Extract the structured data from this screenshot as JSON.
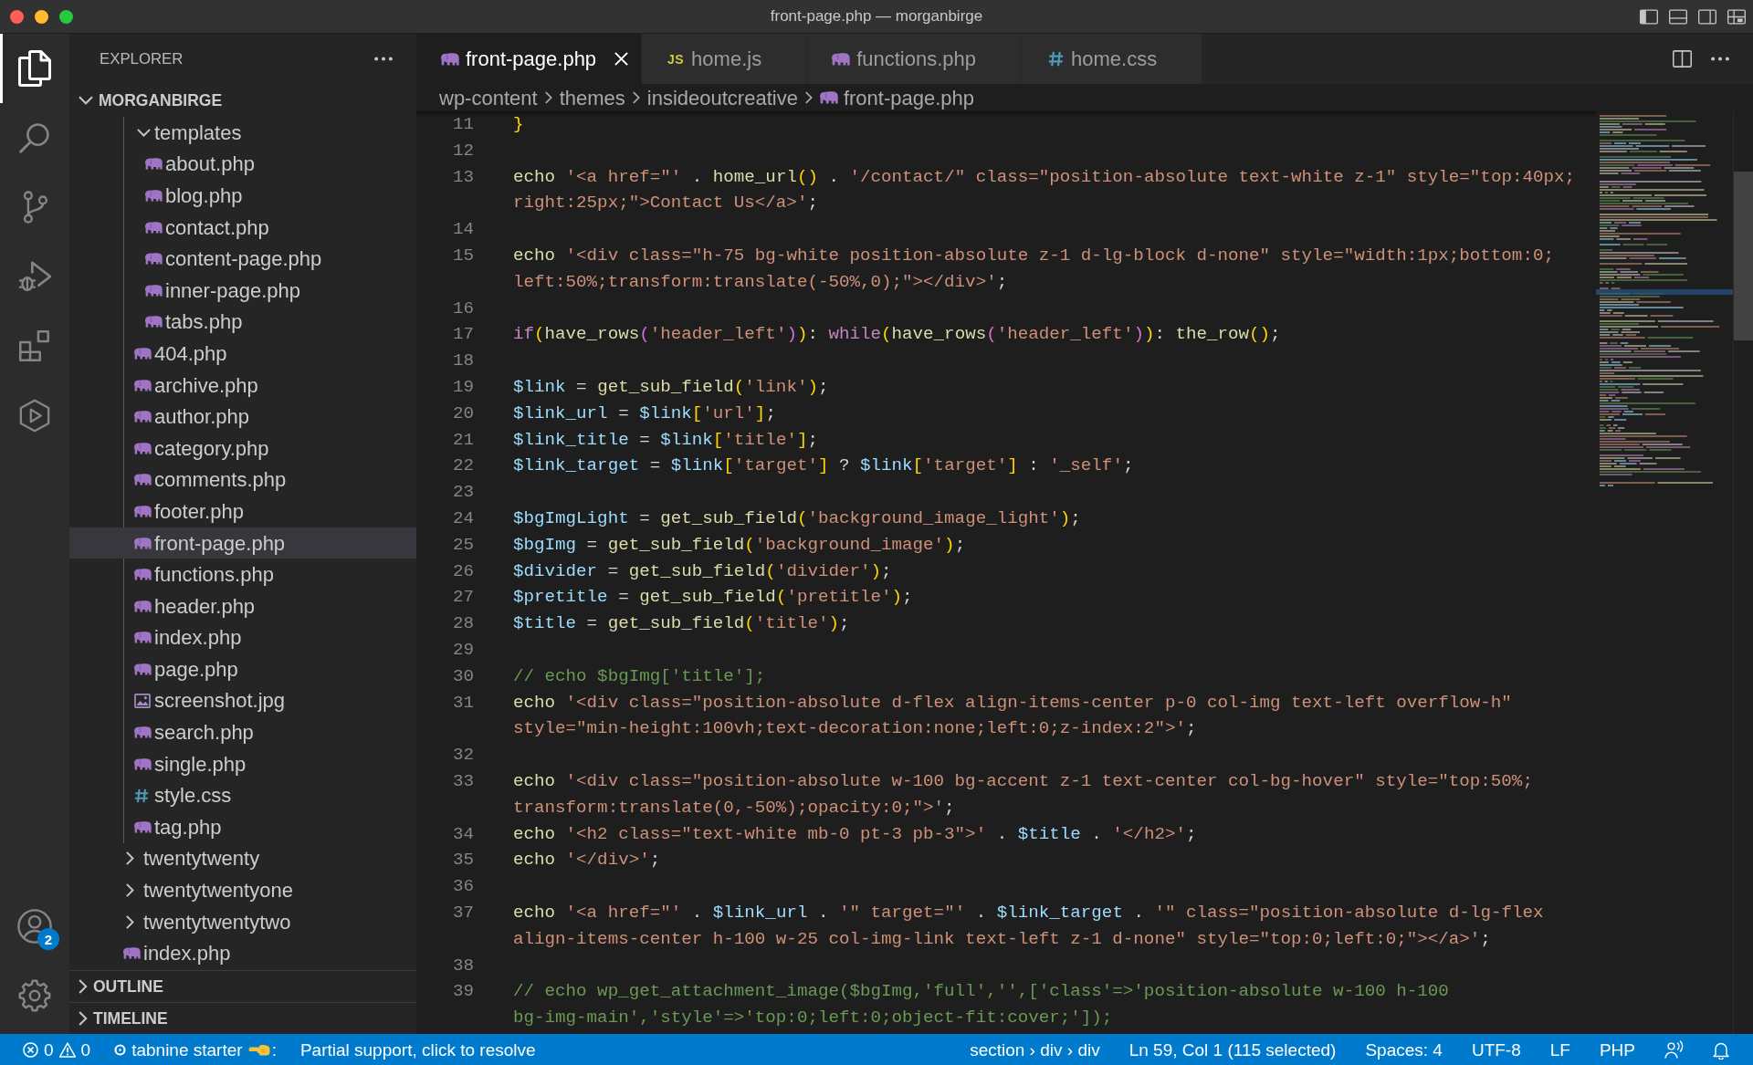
{
  "window": {
    "title": "front-page.php — morganbirge"
  },
  "activity_bar": {
    "items": [
      {
        "kind": "explorer",
        "selected": true
      },
      {
        "kind": "search",
        "selected": false
      },
      {
        "kind": "source_control",
        "selected": false
      },
      {
        "kind": "run_debug",
        "selected": false
      },
      {
        "kind": "extensions",
        "selected": false
      },
      {
        "kind": "custom",
        "selected": false
      }
    ],
    "bottom": [
      {
        "kind": "accounts",
        "badge": "2"
      },
      {
        "kind": "manage"
      }
    ]
  },
  "sidebar": {
    "title": "EXPLORER",
    "folder": {
      "title": "MORGANBIRGE",
      "expanded": true
    },
    "tree": [
      {
        "kind": "group",
        "children": [
          {
            "label": "templates",
            "kind": "folder",
            "expanded": true,
            "selected": false,
            "children": [
              {
                "label": "about.php",
                "kind": "php",
                "selected": false
              },
              {
                "label": "blog.php",
                "kind": "php",
                "selected": false
              },
              {
                "label": "contact.php",
                "kind": "php",
                "selected": false
              },
              {
                "label": "content-page.php",
                "kind": "php",
                "selected": false
              },
              {
                "label": "inner-page.php",
                "kind": "php",
                "selected": false
              },
              {
                "label": "tabs.php",
                "kind": "php",
                "selected": false
              }
            ]
          },
          {
            "label": "404.php",
            "kind": "php",
            "selected": false
          },
          {
            "label": "archive.php",
            "kind": "php",
            "selected": false
          },
          {
            "label": "author.php",
            "kind": "php",
            "selected": false
          },
          {
            "label": "category.php",
            "kind": "php",
            "selected": false
          },
          {
            "label": "comments.php",
            "kind": "php",
            "selected": false
          },
          {
            "label": "footer.php",
            "kind": "php",
            "selected": false
          },
          {
            "label": "front-page.php",
            "kind": "php",
            "selected": true
          },
          {
            "label": "functions.php",
            "kind": "php",
            "selected": false
          },
          {
            "label": "header.php",
            "kind": "php",
            "selected": false
          },
          {
            "label": "index.php",
            "kind": "php",
            "selected": false
          },
          {
            "label": "page.php",
            "kind": "php",
            "selected": false
          },
          {
            "label": "screenshot.jpg",
            "kind": "image",
            "selected": false
          },
          {
            "label": "search.php",
            "kind": "php",
            "selected": false
          },
          {
            "label": "single.php",
            "kind": "php",
            "selected": false
          },
          {
            "label": "style.css",
            "kind": "css",
            "selected": false
          },
          {
            "label": "tag.php",
            "kind": "php",
            "selected": false
          }
        ]
      },
      {
        "label": "twentytwenty",
        "kind": "folder",
        "expanded": false,
        "selected": false
      },
      {
        "label": "twentytwentyone",
        "kind": "folder",
        "expanded": false,
        "selected": false
      },
      {
        "label": "twentytwentytwo",
        "kind": "folder",
        "expanded": false,
        "selected": false
      },
      {
        "label": "index.php",
        "kind": "php",
        "selected": false
      }
    ],
    "panels": [
      {
        "title": "OUTLINE",
        "expanded": false
      },
      {
        "title": "TIMELINE",
        "expanded": false
      }
    ]
  },
  "editor": {
    "tabs": [
      {
        "label": "front-page.php",
        "kind": "php",
        "selected": true
      },
      {
        "label": "home.js",
        "kind": "js",
        "icon_text": "JS",
        "selected": false
      },
      {
        "label": "functions.php",
        "kind": "php",
        "selected": false
      },
      {
        "label": "home.css",
        "kind": "css",
        "selected": false
      }
    ],
    "breadcrumbs": [
      {
        "label": "wp-content",
        "kind": "folder"
      },
      {
        "label": "themes",
        "kind": "folder"
      },
      {
        "label": "insideoutcreative",
        "kind": "folder"
      },
      {
        "label": "front-page.php",
        "kind": "php"
      }
    ],
    "lines": [
      {
        "number": "11",
        "tokens": [
          {
            "text": "}",
            "kind": "bracket"
          }
        ]
      },
      {
        "number": "12"
      },
      {
        "number": "13",
        "tokens": [
          {
            "text": "echo ",
            "kind": "function"
          },
          {
            "text": "'<a href=\"'",
            "kind": "string"
          },
          {
            "text": " . ",
            "kind": "plain"
          },
          {
            "text": "home_url",
            "kind": "function"
          },
          {
            "text": "()",
            "kind": "bracket"
          },
          {
            "text": " . ",
            "kind": "plain"
          },
          {
            "text": "'/contact/\" class=\"position-absolute text-white z-1\" style=\"top:40px;right:25px;\">Contact Us</a>'",
            "kind": "string"
          },
          {
            "text": ";",
            "kind": "plain"
          }
        ]
      },
      {
        "number": "14"
      },
      {
        "number": "15",
        "tokens": [
          {
            "text": "echo ",
            "kind": "function"
          },
          {
            "text": "'<div class=\"h-75 bg-white position-absolute z-1 d-lg-block d-none\" style=\"width:1px;bottom:0;left:50%;transform:translate(-50%,0);\"></div>'",
            "kind": "string"
          },
          {
            "text": ";",
            "kind": "plain"
          }
        ]
      },
      {
        "number": "16"
      },
      {
        "number": "17",
        "tokens": [
          {
            "text": "if",
            "kind": "keyword"
          },
          {
            "text": "(",
            "kind": "bracket"
          },
          {
            "text": "have_rows",
            "kind": "function"
          },
          {
            "text": "(",
            "kind": "bracket_nested"
          },
          {
            "text": "'header_left'",
            "kind": "string"
          },
          {
            "text": ")",
            "kind": "bracket_nested"
          },
          {
            "text": ")",
            "kind": "bracket"
          },
          {
            "text": ": ",
            "kind": "plain"
          },
          {
            "text": "while",
            "kind": "keyword"
          },
          {
            "text": "(",
            "kind": "bracket"
          },
          {
            "text": "have_rows",
            "kind": "function"
          },
          {
            "text": "(",
            "kind": "bracket_nested"
          },
          {
            "text": "'header_left'",
            "kind": "string"
          },
          {
            "text": ")",
            "kind": "bracket_nested"
          },
          {
            "text": ")",
            "kind": "bracket"
          },
          {
            "text": ": ",
            "kind": "plain"
          },
          {
            "text": "the_row",
            "kind": "function"
          },
          {
            "text": "()",
            "kind": "bracket"
          },
          {
            "text": ";",
            "kind": "plain"
          }
        ]
      },
      {
        "number": "18"
      },
      {
        "number": "19",
        "tokens": [
          {
            "text": "$link",
            "kind": "variable"
          },
          {
            "text": " = ",
            "kind": "plain"
          },
          {
            "text": "get_sub_field",
            "kind": "function"
          },
          {
            "text": "(",
            "kind": "bracket"
          },
          {
            "text": "'link'",
            "kind": "string"
          },
          {
            "text": ")",
            "kind": "bracket"
          },
          {
            "text": ";",
            "kind": "plain"
          }
        ]
      },
      {
        "number": "20",
        "tokens": [
          {
            "text": "$link_url",
            "kind": "variable"
          },
          {
            "text": " = ",
            "kind": "plain"
          },
          {
            "text": "$link",
            "kind": "variable"
          },
          {
            "text": "[",
            "kind": "bracket"
          },
          {
            "text": "'url'",
            "kind": "string"
          },
          {
            "text": "]",
            "kind": "bracket"
          },
          {
            "text": ";",
            "kind": "plain"
          }
        ]
      },
      {
        "number": "21",
        "tokens": [
          {
            "text": "$link_title",
            "kind": "variable"
          },
          {
            "text": " = ",
            "kind": "plain"
          },
          {
            "text": "$link",
            "kind": "variable"
          },
          {
            "text": "[",
            "kind": "bracket"
          },
          {
            "text": "'title'",
            "kind": "string"
          },
          {
            "text": "]",
            "kind": "bracket"
          },
          {
            "text": ";",
            "kind": "plain"
          }
        ]
      },
      {
        "number": "22",
        "tokens": [
          {
            "text": "$link_target",
            "kind": "variable"
          },
          {
            "text": " = ",
            "kind": "plain"
          },
          {
            "text": "$link",
            "kind": "variable"
          },
          {
            "text": "[",
            "kind": "bracket"
          },
          {
            "text": "'target'",
            "kind": "string"
          },
          {
            "text": "]",
            "kind": "bracket"
          },
          {
            "text": " ? ",
            "kind": "plain"
          },
          {
            "text": "$link",
            "kind": "variable"
          },
          {
            "text": "[",
            "kind": "bracket"
          },
          {
            "text": "'target'",
            "kind": "string"
          },
          {
            "text": "]",
            "kind": "bracket"
          },
          {
            "text": " : ",
            "kind": "plain"
          },
          {
            "text": "'_self'",
            "kind": "string"
          },
          {
            "text": ";",
            "kind": "plain"
          }
        ]
      },
      {
        "number": "23"
      },
      {
        "number": "24",
        "tokens": [
          {
            "text": "$bgImgLight",
            "kind": "variable"
          },
          {
            "text": " = ",
            "kind": "plain"
          },
          {
            "text": "get_sub_field",
            "kind": "function"
          },
          {
            "text": "(",
            "kind": "bracket"
          },
          {
            "text": "'background_image_light'",
            "kind": "string"
          },
          {
            "text": ")",
            "kind": "bracket"
          },
          {
            "text": ";",
            "kind": "plain"
          }
        ]
      },
      {
        "number": "25",
        "tokens": [
          {
            "text": "$bgImg",
            "kind": "variable"
          },
          {
            "text": " = ",
            "kind": "plain"
          },
          {
            "text": "get_sub_field",
            "kind": "function"
          },
          {
            "text": "(",
            "kind": "bracket"
          },
          {
            "text": "'background_image'",
            "kind": "string"
          },
          {
            "text": ")",
            "kind": "bracket"
          },
          {
            "text": ";",
            "kind": "plain"
          }
        ]
      },
      {
        "number": "26",
        "tokens": [
          {
            "text": "$divider",
            "kind": "variable"
          },
          {
            "text": " = ",
            "kind": "plain"
          },
          {
            "text": "get_sub_field",
            "kind": "function"
          },
          {
            "text": "(",
            "kind": "bracket"
          },
          {
            "text": "'divider'",
            "kind": "string"
          },
          {
            "text": ")",
            "kind": "bracket"
          },
          {
            "text": ";",
            "kind": "plain"
          }
        ]
      },
      {
        "number": "27",
        "tokens": [
          {
            "text": "$pretitle",
            "kind": "variable"
          },
          {
            "text": " = ",
            "kind": "plain"
          },
          {
            "text": "get_sub_field",
            "kind": "function"
          },
          {
            "text": "(",
            "kind": "bracket"
          },
          {
            "text": "'pretitle'",
            "kind": "string"
          },
          {
            "text": ")",
            "kind": "bracket"
          },
          {
            "text": ";",
            "kind": "plain"
          }
        ]
      },
      {
        "number": "28",
        "tokens": [
          {
            "text": "$title",
            "kind": "variable"
          },
          {
            "text": " = ",
            "kind": "plain"
          },
          {
            "text": "get_sub_field",
            "kind": "function"
          },
          {
            "text": "(",
            "kind": "bracket"
          },
          {
            "text": "'title'",
            "kind": "string"
          },
          {
            "text": ")",
            "kind": "bracket"
          },
          {
            "text": ";",
            "kind": "plain"
          }
        ]
      },
      {
        "number": "29"
      },
      {
        "number": "30",
        "tokens": [
          {
            "text": "// echo $bgImg['title'];",
            "kind": "comment"
          }
        ]
      },
      {
        "number": "31",
        "tokens": [
          {
            "text": "echo ",
            "kind": "function"
          },
          {
            "text": "'<div class=\"position-absolute d-flex align-items-center p-0 col-img text-left overflow-h\" style=\"min-height:100vh;text-decoration:none;left:0;z-index:2\">'",
            "kind": "string"
          },
          {
            "text": ";",
            "kind": "plain"
          }
        ]
      },
      {
        "number": "32"
      },
      {
        "number": "33",
        "tokens": [
          {
            "text": "echo ",
            "kind": "function"
          },
          {
            "text": "'<div class=\"position-absolute w-100 bg-accent z-1 text-center col-bg-hover\" style=\"top:50%;transform:translate(0,-50%);opacity:0;\">'",
            "kind": "string"
          },
          {
            "text": ";",
            "kind": "plain"
          }
        ]
      },
      {
        "number": "34",
        "tokens": [
          {
            "text": "echo ",
            "kind": "function"
          },
          {
            "text": "'<h2 class=\"text-white mb-0 pt-3 pb-3\">'",
            "kind": "string"
          },
          {
            "text": " . ",
            "kind": "plain"
          },
          {
            "text": "$title",
            "kind": "variable"
          },
          {
            "text": " . ",
            "kind": "plain"
          },
          {
            "text": "'</h2>'",
            "kind": "string"
          },
          {
            "text": ";",
            "kind": "plain"
          }
        ]
      },
      {
        "number": "35",
        "tokens": [
          {
            "text": "echo ",
            "kind": "function"
          },
          {
            "text": "'</div>'",
            "kind": "string"
          },
          {
            "text": ";",
            "kind": "plain"
          }
        ]
      },
      {
        "number": "36"
      },
      {
        "number": "37",
        "tokens": [
          {
            "text": "echo ",
            "kind": "function"
          },
          {
            "text": "'<a href=\"'",
            "kind": "string"
          },
          {
            "text": " . ",
            "kind": "plain"
          },
          {
            "text": "$link_url",
            "kind": "variable"
          },
          {
            "text": " . ",
            "kind": "plain"
          },
          {
            "text": "'\" target=\"'",
            "kind": "string"
          },
          {
            "text": " . ",
            "kind": "plain"
          },
          {
            "text": "$link_target",
            "kind": "variable"
          },
          {
            "text": " . ",
            "kind": "plain"
          },
          {
            "text": "'\" class=\"position-absolute d-lg-flex align-items-center h-100 w-25 col-img-link text-left z-1 d-none\" style=\"top:0;left:0;\"></a>'",
            "kind": "string"
          },
          {
            "text": ";",
            "kind": "plain"
          }
        ]
      },
      {
        "number": "38"
      },
      {
        "number": "39",
        "tokens": [
          {
            "text": "// echo wp_get_attachment_image($bgImg,'full','',['class'=>'position-absolute w-100 h-100 bg-img-main','style'=>'top:0;left:0;object-fit:cover;']);",
            "kind": "comment"
          }
        ]
      }
    ]
  },
  "status_bar": {
    "left": [
      {
        "kind": "problems",
        "errors": "0",
        "warnings": "0"
      },
      {
        "kind": "tabnine",
        "label": "tabnine starter",
        "suffix": ":"
      },
      {
        "kind": "text",
        "label": "Partial support, click to resolve"
      }
    ],
    "right": [
      {
        "kind": "text",
        "label": "section › div › div"
      },
      {
        "kind": "text",
        "label": "Ln 59, Col 1 (115 selected)"
      },
      {
        "kind": "text",
        "label": "Spaces: 4"
      },
      {
        "kind": "text",
        "label": "UTF-8"
      },
      {
        "kind": "text",
        "label": "LF"
      },
      {
        "kind": "text",
        "label": "PHP"
      },
      {
        "kind": "feedback"
      },
      {
        "kind": "notifications"
      }
    ]
  }
}
